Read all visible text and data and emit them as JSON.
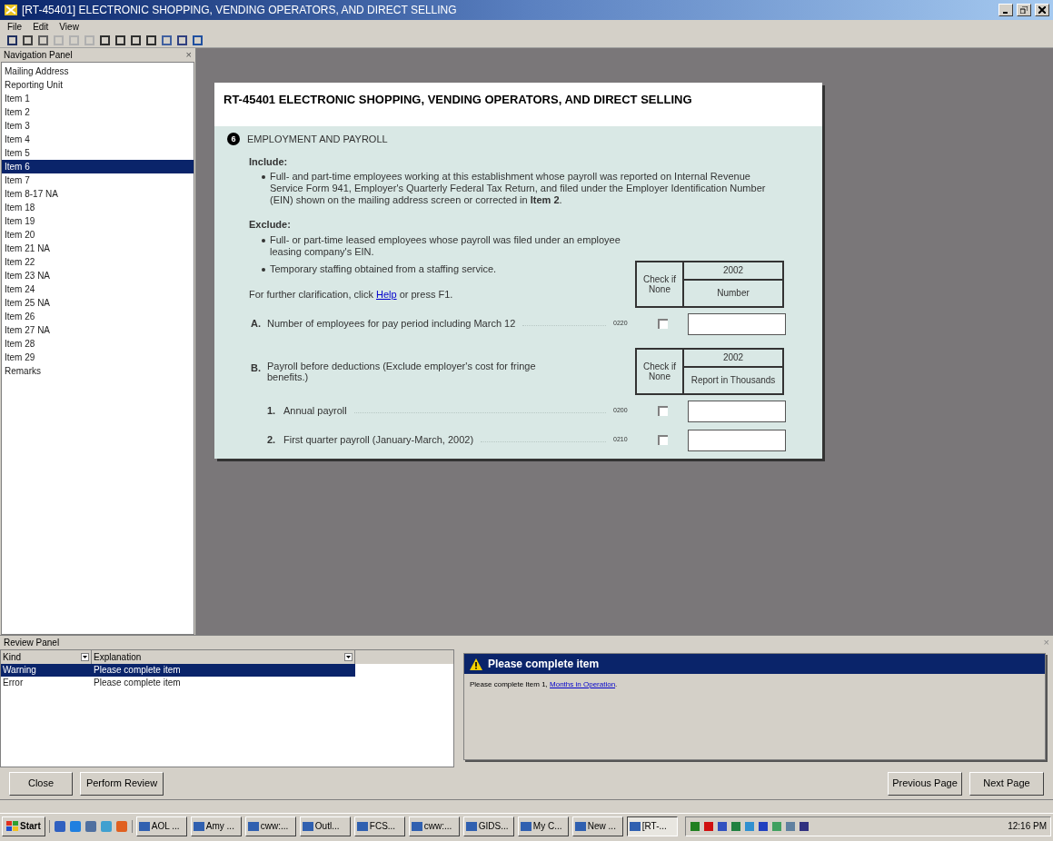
{
  "window": {
    "title": "[RT-45401] ELECTRONIC SHOPPING, VENDING OPERATORS, AND DIRECT SELLING"
  },
  "menu": [
    "File",
    "Edit",
    "View"
  ],
  "navigation": {
    "title": "Navigation Panel",
    "close": "×",
    "items": [
      {
        "label": "Mailing Address",
        "selected": false
      },
      {
        "label": "Reporting Unit",
        "selected": false
      },
      {
        "label": "Item 1",
        "selected": false
      },
      {
        "label": "Item 2",
        "selected": false
      },
      {
        "label": "Item 3",
        "selected": false
      },
      {
        "label": "Item 4",
        "selected": false
      },
      {
        "label": "Item 5",
        "selected": false
      },
      {
        "label": "Item 6",
        "selected": true
      },
      {
        "label": "Item 7",
        "selected": false
      },
      {
        "label": "Item 8-17 NA",
        "selected": false
      },
      {
        "label": "Item 18",
        "selected": false
      },
      {
        "label": "Item 19",
        "selected": false
      },
      {
        "label": "Item 20",
        "selected": false
      },
      {
        "label": "Item 21 NA",
        "selected": false
      },
      {
        "label": "Item 22",
        "selected": false
      },
      {
        "label": "Item 23 NA",
        "selected": false
      },
      {
        "label": "Item 24",
        "selected": false
      },
      {
        "label": "Item 25 NA",
        "selected": false
      },
      {
        "label": "Item 26",
        "selected": false
      },
      {
        "label": "Item 27 NA",
        "selected": false
      },
      {
        "label": "Item 28",
        "selected": false
      },
      {
        "label": "Item 29",
        "selected": false
      },
      {
        "label": "Remarks",
        "selected": false
      }
    ]
  },
  "form": {
    "title": "RT-45401 ELECTRONIC SHOPPING, VENDING OPERATORS, AND DIRECT SELLING",
    "section_number": "6",
    "section_title": "EMPLOYMENT AND PAYROLL",
    "include_label": "Include:",
    "include": [
      "Full- and part-time employees working at this establishment whose payroll was reported on Internal Revenue Service Form 941, Employer's Quarterly Federal Tax Return, and filed under the Employer Identification Number (EIN) shown on the mailing address screen or corrected in **Item 2**."
    ],
    "exclude_label": "Exclude:",
    "exclude": [
      "Full- or part-time leased employees whose payroll was filed under an employee leasing company's EIN.",
      "Temporary staffing obtained from a staffing service."
    ],
    "help": {
      "before": "For further clarification, click ",
      "link": "Help",
      "after": " or press F1."
    },
    "header_a": {
      "check": "Check if None",
      "year": "2002",
      "unit": "Number"
    },
    "item_a": {
      "letter": "A.",
      "label": "Number of employees for pay period including March 12",
      "code": "0220",
      "checked": false
    },
    "header_b": {
      "check": "Check if None",
      "year": "2002",
      "unit": "Report in Thousands"
    },
    "item_b": {
      "letter": "B.",
      "label": "Payroll before deductions (Exclude employer's cost for fringe benefits.)"
    },
    "sub_items": [
      {
        "number": "1.",
        "label": "Annual payroll",
        "code": "0200",
        "checked": false
      },
      {
        "number": "2.",
        "label": "First quarter payroll (January-March, 2002)",
        "code": "0210",
        "checked": false
      }
    ]
  },
  "review": {
    "title": "Review Panel",
    "close": "×",
    "columns": [
      "Kind",
      "Explanation"
    ],
    "rows": [
      {
        "kind": "Warning",
        "explanation": "Please complete item",
        "selected": true
      },
      {
        "kind": "Error",
        "explanation": "Please complete item",
        "selected": false
      }
    ],
    "message_title": "Please complete item",
    "message": {
      "before": "Please complete Item 1, ",
      "link": "Months in Operation",
      "after": "."
    }
  },
  "buttons_left": [
    "Close",
    "Perform Review"
  ],
  "buttons_right": [
    "Previous Page",
    "Next Page"
  ],
  "taskbar": {
    "start": "Start",
    "tasks": [
      {
        "label": "AOL ...",
        "selected": false
      },
      {
        "label": "Amy ...",
        "selected": false
      },
      {
        "label": "cww:...",
        "selected": false
      },
      {
        "label": "Outl...",
        "selected": false
      },
      {
        "label": "FCS...",
        "selected": false
      },
      {
        "label": "cww:...",
        "selected": false
      },
      {
        "label": "GIDS...",
        "selected": false
      },
      {
        "label": "My C...",
        "selected": false
      },
      {
        "label": "New ...",
        "selected": false
      },
      {
        "label": "[RT-...",
        "selected": true
      }
    ],
    "time": "12:16 PM"
  }
}
